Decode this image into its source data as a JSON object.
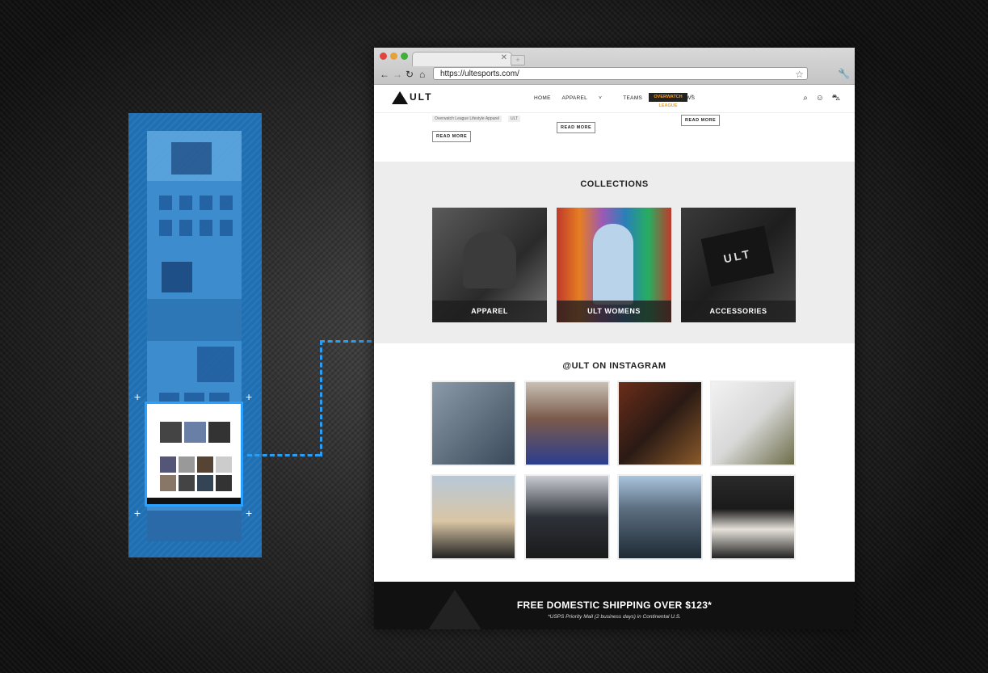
{
  "browser": {
    "url": "https://ultesports.com/"
  },
  "site": {
    "logo": "ULT",
    "nav": [
      "HOME",
      "APPAREL",
      "TEAMS",
      "NEWS"
    ],
    "owl_badge": "OVERWATCH LEAGUE"
  },
  "articles": {
    "tags": [
      "Overwatch League Lifestyle Apparel",
      "ULT"
    ],
    "read_more": "READ MORE"
  },
  "collections": {
    "title": "COLLECTIONS",
    "items": [
      "APPAREL",
      "ULT WOMENS",
      "ACCESSORIES"
    ]
  },
  "instagram": {
    "title": "@ULT ON INSTAGRAM"
  },
  "shipping": {
    "headline": "FREE DOMESTIC SHIPPING OVER $123*",
    "note": "*USPS Priority Mail (2 business days) in Continental U.S."
  },
  "icons": [
    "search-icon",
    "account-icon",
    "cart-icon",
    "home-icon",
    "back-icon",
    "forward-icon",
    "reload-icon",
    "star-icon",
    "wrench-icon"
  ]
}
